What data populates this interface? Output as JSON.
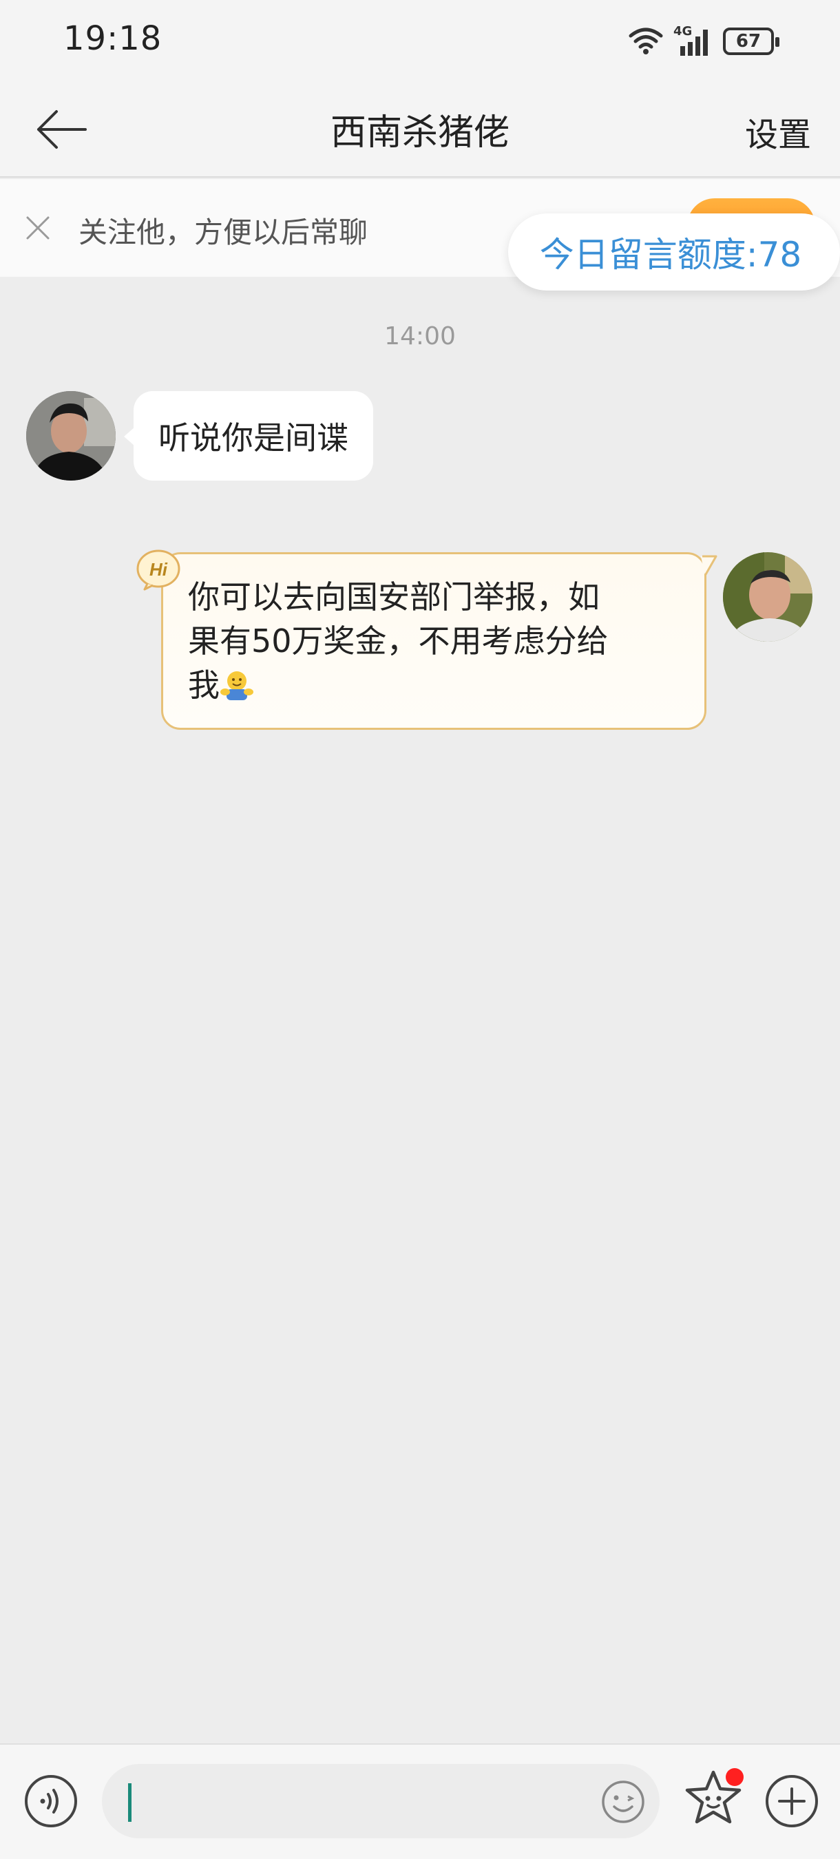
{
  "status_bar": {
    "time": "19:18",
    "network": "4G",
    "battery": "67"
  },
  "header": {
    "title": "西南杀猪佬",
    "settings_label": "设置"
  },
  "follow_banner": {
    "text": "关注他，方便以后常聊"
  },
  "quota": {
    "text": "今日留言额度:78"
  },
  "chat": {
    "timestamp": "14:00",
    "messages": [
      {
        "direction": "incoming",
        "text": "听说你是间谍"
      },
      {
        "direction": "outgoing",
        "badge": "Hi",
        "line1": "你可以去向国安部门举报，如",
        "line2": "果有50万奖金，不用考虑分给",
        "line3": "我"
      }
    ]
  },
  "input": {
    "placeholder": "",
    "value": ""
  },
  "colors": {
    "accent": "#3a8fd6",
    "follow_button": "#ff9a2a",
    "outgoing_border": "#e7c178",
    "caret": "#1a8a7a",
    "notification_dot": "#ff2020"
  },
  "icons": {
    "back": "arrow-left-icon",
    "close": "close-icon",
    "voice": "voice-icon",
    "emoji": "emoji-icon",
    "sticker": "sticker-icon",
    "plus": "plus-icon"
  }
}
